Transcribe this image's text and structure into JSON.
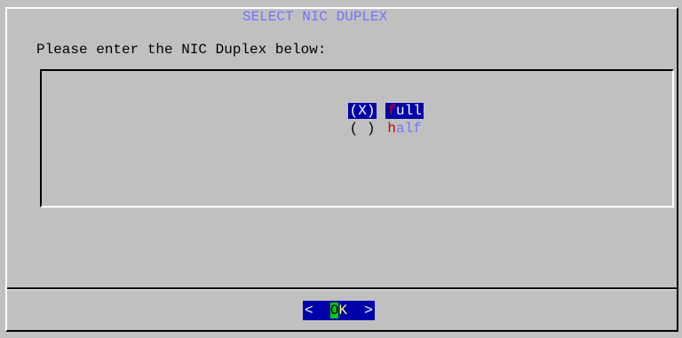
{
  "dialog": {
    "title": "SELECT NIC DUPLEX",
    "prompt": "Please enter the NIC Duplex below:"
  },
  "options": [
    {
      "marker": "(X)",
      "hotkey": "f",
      "rest": "ull",
      "selected": true
    },
    {
      "marker": "( )",
      "hotkey": "h",
      "rest": "alf",
      "selected": false
    }
  ],
  "ok_button": {
    "left": "<",
    "hotkey": "O",
    "rest": "K",
    "right": ">"
  }
}
